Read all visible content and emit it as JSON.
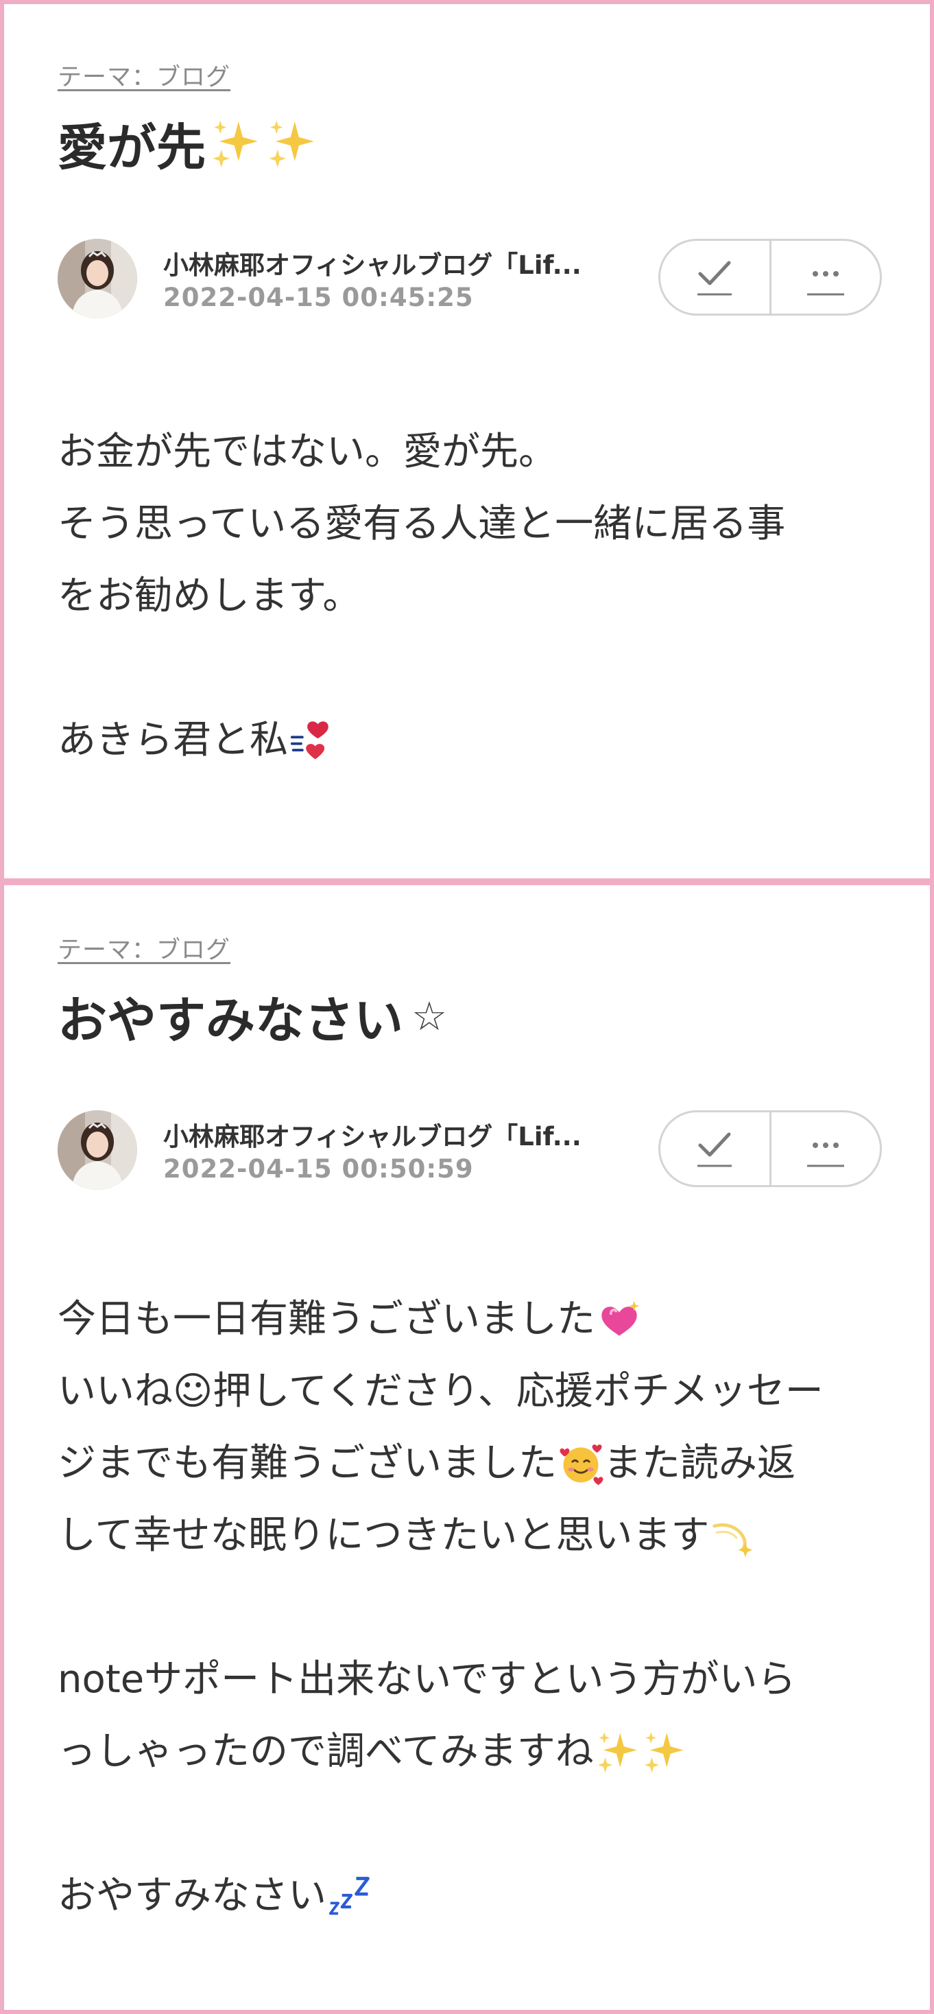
{
  "posts": [
    {
      "theme": "テーマ：ブログ",
      "title": "愛が先",
      "title_icons": [
        "sparkles-icon",
        "sparkles-icon"
      ],
      "blog_name": "小林麻耶オフィシャルブログ「Lif...",
      "date": "2022-04-15 00:45:25",
      "body": [
        "お金が先ではない。愛が先。",
        "そう思っている愛有る人達と一緒に居る事",
        "をお勧めします。",
        "",
        "あきら君と私"
      ]
    },
    {
      "theme": "テーマ：ブログ",
      "title": "おやすみなさい",
      "title_suffix": "☆",
      "blog_name": "小林麻耶オフィシャルブログ「Lif...",
      "date": "2022-04-15 00:50:59",
      "body": [
        "今日も一日有難うございました",
        "いいね☺押してくださり、応援ポチメッセー",
        "ジまでも有難うございました",
        "また読み返",
        "して幸せな眠りにつきたいと思います",
        "",
        "noteサポート出来ないですという方がいら",
        "っしゃったので調べてみますね",
        "",
        "おやすみなさい"
      ]
    }
  ],
  "colors": {
    "frame_pink": "#f0adc6",
    "sparkle_gold": "#f5c842",
    "heart_red": "#e0304a"
  }
}
